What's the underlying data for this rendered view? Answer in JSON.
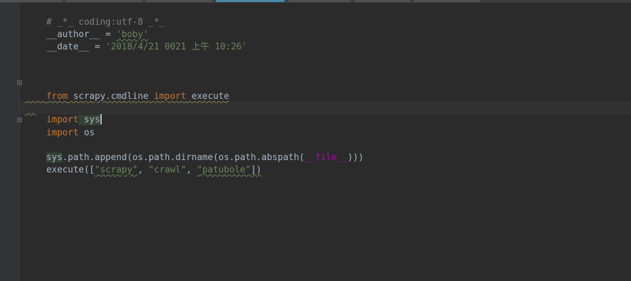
{
  "editor": {
    "lines": {
      "l1": "# _*_ coding:utf-8 _*_",
      "l2_a": "__author__",
      "l2_b": " = ",
      "l2_c": "'boby'",
      "l3_a": "__date__",
      "l3_b": " = ",
      "l3_c": "'2018/4/21 0021 上午 10:26'",
      "l7_a": "from",
      "l7_b": " scrapy.cmdline ",
      "l7_c": "import",
      "l7_d": " execute",
      "l9_a": "import",
      "l9_b": " sys",
      "l10_a": "import",
      "l10_b": " os",
      "l12_a": "sys",
      "l12_b": ".path.append(os.path.dirname(os.path.abspath(",
      "l12_c": "__file__",
      "l12_d": ")))",
      "l13_a": "execute([",
      "l13_b": "\"scrapy\"",
      "l13_c": ", ",
      "l13_d": "\"crawl\"",
      "l13_e": ", ",
      "l13_f": "\"patubole\"",
      "l13_g": "])"
    },
    "colors": {
      "background": "#2b2b2b",
      "keyword": "#cc7832",
      "string": "#6a8759",
      "comment": "#808080",
      "default": "#a9b7c6"
    }
  }
}
